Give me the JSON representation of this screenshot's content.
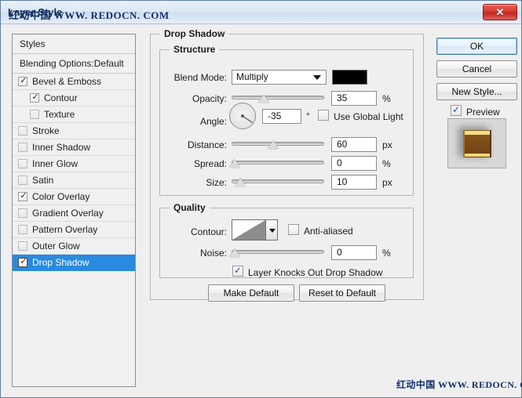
{
  "window": {
    "title": "Layer Style",
    "watermark_title": "红动中国 WWW. REDOCN. COM",
    "watermark_bottom": "红动中国 WWW. REDOCN. COM",
    "close_label": "✕"
  },
  "styles_panel": {
    "header": "Styles",
    "blending_options": "Blending Options:Default",
    "items": [
      {
        "label": "Bevel & Emboss",
        "checked": true,
        "indent": false,
        "selected": false
      },
      {
        "label": "Contour",
        "checked": true,
        "indent": true,
        "selected": false
      },
      {
        "label": "Texture",
        "checked": false,
        "indent": true,
        "selected": false
      },
      {
        "label": "Stroke",
        "checked": false,
        "indent": false,
        "selected": false
      },
      {
        "label": "Inner Shadow",
        "checked": false,
        "indent": false,
        "selected": false
      },
      {
        "label": "Inner Glow",
        "checked": false,
        "indent": false,
        "selected": false
      },
      {
        "label": "Satin",
        "checked": false,
        "indent": false,
        "selected": false
      },
      {
        "label": "Color Overlay",
        "checked": true,
        "indent": false,
        "selected": false
      },
      {
        "label": "Gradient Overlay",
        "checked": false,
        "indent": false,
        "selected": false
      },
      {
        "label": "Pattern Overlay",
        "checked": false,
        "indent": false,
        "selected": false
      },
      {
        "label": "Outer Glow",
        "checked": false,
        "indent": false,
        "selected": false
      },
      {
        "label": "Drop Shadow",
        "checked": true,
        "indent": false,
        "selected": true
      }
    ]
  },
  "main": {
    "group_title": "Drop Shadow",
    "structure": {
      "title": "Structure",
      "blend_mode_label": "Blend Mode:",
      "blend_mode_value": "Multiply",
      "shadow_color": "#000000",
      "opacity_label": "Opacity:",
      "opacity_value": "35",
      "opacity_unit": "%",
      "angle_label": "Angle:",
      "angle_value": "-35",
      "angle_unit": "°",
      "use_global_light_label": "Use Global Light",
      "use_global_light_checked": false,
      "distance_label": "Distance:",
      "distance_value": "60",
      "distance_unit": "px",
      "spread_label": "Spread:",
      "spread_value": "0",
      "spread_unit": "%",
      "size_label": "Size:",
      "size_value": "10",
      "size_unit": "px"
    },
    "quality": {
      "title": "Quality",
      "contour_label": "Contour:",
      "anti_aliased_label": "Anti-aliased",
      "anti_aliased_checked": false,
      "noise_label": "Noise:",
      "noise_value": "0",
      "noise_unit": "%"
    },
    "knockout_label": "Layer Knocks Out Drop Shadow",
    "knockout_checked": true,
    "make_default_label": "Make Default",
    "reset_default_label": "Reset to Default"
  },
  "actions": {
    "ok_label": "OK",
    "cancel_label": "Cancel",
    "new_style_label": "New Style...",
    "preview_label": "Preview",
    "preview_checked": true
  },
  "preview_swatch": {
    "fill": "#7b4a17",
    "highlight": "#f5e08a",
    "shadow": "#8a8a8a"
  }
}
